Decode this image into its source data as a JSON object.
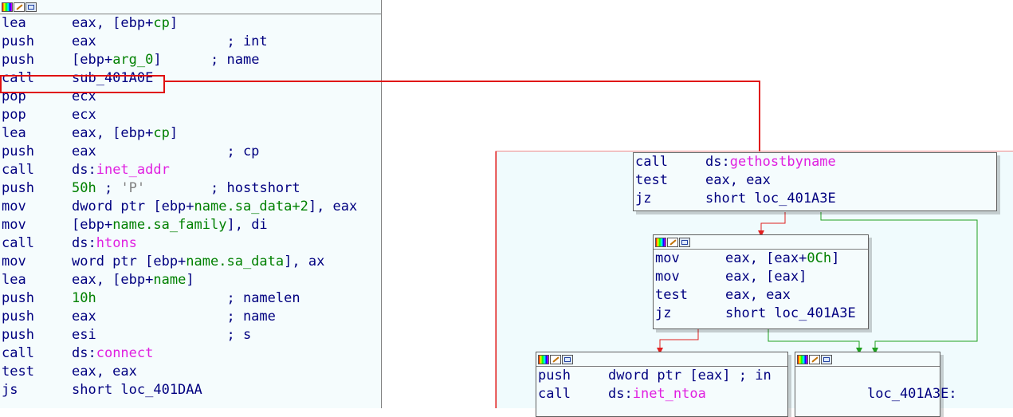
{
  "left_listing": [
    {
      "mn": "lea",
      "ops": [
        {
          "t": "eax, [ebp+"
        },
        {
          "t": "cp",
          "c": "hl"
        },
        {
          "t": "]"
        }
      ]
    },
    {
      "mn": "push",
      "ops": [
        {
          "t": "eax                "
        },
        {
          "t": "; int",
          "c": "cm"
        }
      ]
    },
    {
      "mn": "push",
      "ops": [
        {
          "t": "[ebp+"
        },
        {
          "t": "arg_0",
          "c": "hl"
        },
        {
          "t": "]      "
        },
        {
          "t": "; name",
          "c": "cm"
        }
      ]
    },
    {
      "mn": "call",
      "ops": [
        {
          "t": "sub_401A0E"
        }
      ]
    },
    {
      "mn": "pop",
      "ops": [
        {
          "t": "ecx"
        }
      ]
    },
    {
      "mn": "pop",
      "ops": [
        {
          "t": "ecx"
        }
      ]
    },
    {
      "mn": "lea",
      "ops": [
        {
          "t": "eax, [ebp+"
        },
        {
          "t": "cp",
          "c": "hl"
        },
        {
          "t": "]"
        }
      ]
    },
    {
      "mn": "push",
      "ops": [
        {
          "t": "eax                "
        },
        {
          "t": "; cp",
          "c": "cm"
        }
      ]
    },
    {
      "mn": "call",
      "ops": [
        {
          "t": "ds:"
        },
        {
          "t": "inet_addr",
          "c": "fn"
        }
      ]
    },
    {
      "mn": "push",
      "ops": [
        {
          "t": "50h",
          "c": "hl"
        },
        {
          "t": " ; "
        },
        {
          "t": "'P'",
          "c": "gr"
        },
        {
          "t": "        "
        },
        {
          "t": "; hostshort",
          "c": "cm"
        }
      ]
    },
    {
      "mn": "mov",
      "ops": [
        {
          "t": "dword ptr [ebp+"
        },
        {
          "t": "name.sa_data+2",
          "c": "hl"
        },
        {
          "t": "], eax"
        }
      ]
    },
    {
      "mn": "mov",
      "ops": [
        {
          "t": "[ebp+"
        },
        {
          "t": "name.sa_family",
          "c": "hl"
        },
        {
          "t": "], di"
        }
      ]
    },
    {
      "mn": "call",
      "ops": [
        {
          "t": "ds:"
        },
        {
          "t": "htons",
          "c": "fn"
        }
      ]
    },
    {
      "mn": "mov",
      "ops": [
        {
          "t": "word ptr [ebp+"
        },
        {
          "t": "name.sa_data",
          "c": "hl"
        },
        {
          "t": "], ax"
        }
      ]
    },
    {
      "mn": "lea",
      "ops": [
        {
          "t": "eax, [ebp+"
        },
        {
          "t": "name",
          "c": "hl"
        },
        {
          "t": "]"
        }
      ]
    },
    {
      "mn": "push",
      "ops": [
        {
          "t": "10h",
          "c": "hl"
        },
        {
          "t": "                "
        },
        {
          "t": "; namelen",
          "c": "cm"
        }
      ]
    },
    {
      "mn": "push",
      "ops": [
        {
          "t": "eax                "
        },
        {
          "t": "; name",
          "c": "cm"
        }
      ]
    },
    {
      "mn": "push",
      "ops": [
        {
          "t": "esi                "
        },
        {
          "t": "; s",
          "c": "cm"
        }
      ]
    },
    {
      "mn": "call",
      "ops": [
        {
          "t": "ds:"
        },
        {
          "t": "connect",
          "c": "fn"
        }
      ]
    },
    {
      "mn": "test",
      "ops": [
        {
          "t": "eax, eax"
        }
      ]
    },
    {
      "mn": "js",
      "ops": [
        {
          "t": "short loc_401DAA"
        }
      ]
    }
  ],
  "node_a": [
    {
      "mn": "call",
      "ops": [
        {
          "t": "ds:"
        },
        {
          "t": "gethostbyname",
          "c": "fn"
        }
      ]
    },
    {
      "mn": "test",
      "ops": [
        {
          "t": "eax, eax"
        }
      ]
    },
    {
      "mn": "jz",
      "ops": [
        {
          "t": "short loc_401A3E"
        }
      ]
    }
  ],
  "node_b": [
    {
      "mn": "mov",
      "ops": [
        {
          "t": "eax, [eax+"
        },
        {
          "t": "0Ch",
          "c": "hl"
        },
        {
          "t": "]"
        }
      ]
    },
    {
      "mn": "mov",
      "ops": [
        {
          "t": "eax, [eax]"
        }
      ]
    },
    {
      "mn": "test",
      "ops": [
        {
          "t": "eax, eax"
        }
      ]
    },
    {
      "mn": "jz",
      "ops": [
        {
          "t": "short loc_401A3E"
        }
      ]
    }
  ],
  "node_c": [
    {
      "mn": "push",
      "ops": [
        {
          "t": "dword ptr [eax] "
        },
        {
          "t": "; in",
          "c": "cm"
        }
      ]
    },
    {
      "mn": "call",
      "ops": [
        {
          "t": "ds:"
        },
        {
          "t": "inet_ntoa",
          "c": "fn"
        }
      ]
    }
  ],
  "node_d": [
    {
      "mn": "",
      "ops": [
        {
          "t": ""
        }
      ]
    },
    {
      "mn": "",
      "ops": [
        {
          "t": "loc_401A3E:"
        }
      ]
    }
  ],
  "colors": {
    "highlight": "#e01010",
    "true_edge": "#e02020",
    "false_edge": "#20a020",
    "bg": "#f5fcfd"
  }
}
